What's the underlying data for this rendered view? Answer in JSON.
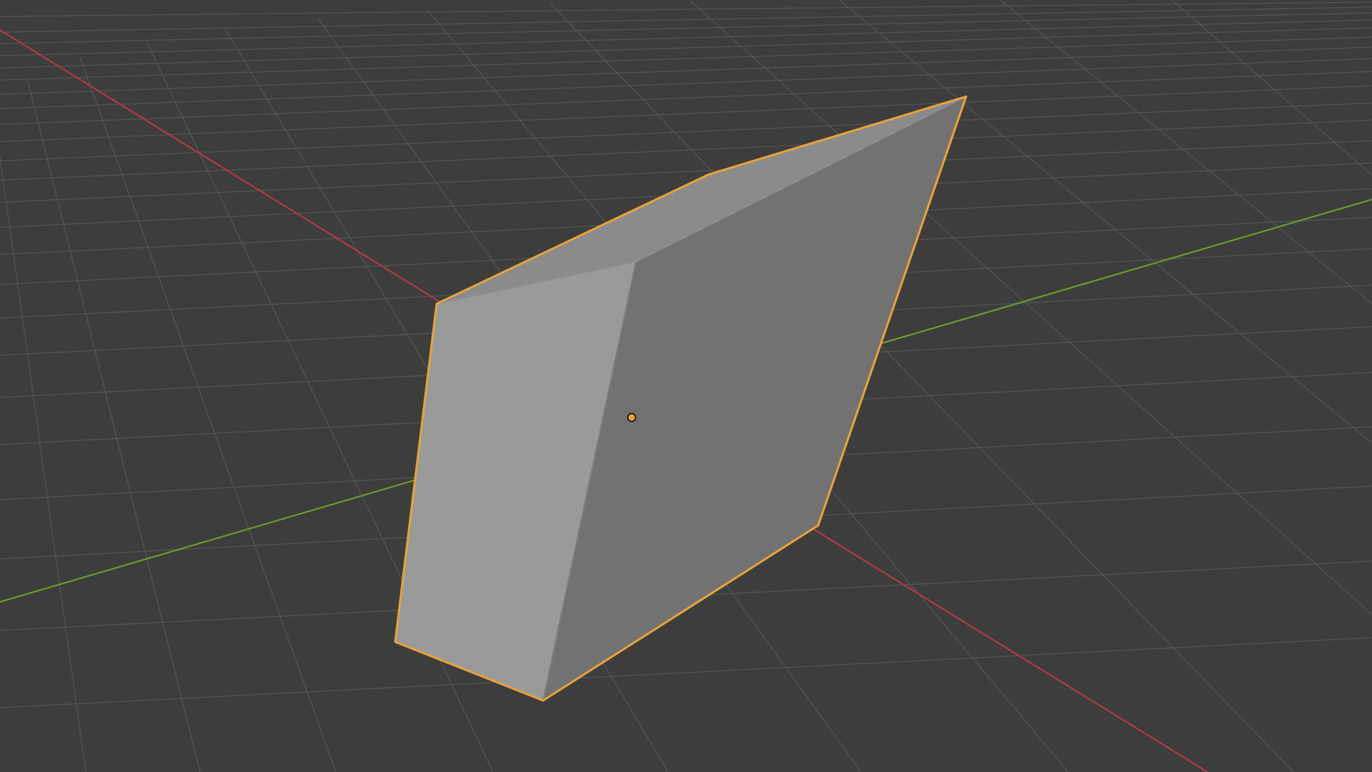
{
  "viewport": {
    "background_color": "#3d3d3d",
    "grid_color": "#545454",
    "x_axis_color": "#b23a48",
    "y_axis_color": "#6f9a2c",
    "selection_outline_color": "#e8a33a",
    "mesh_face_light": "#9a9a9a",
    "mesh_face_dark": "#727272",
    "mesh_face_top": "#8b8b8b"
  },
  "scene": {
    "selected_object": "mesh",
    "origin_marker": "object-origin-dot"
  }
}
